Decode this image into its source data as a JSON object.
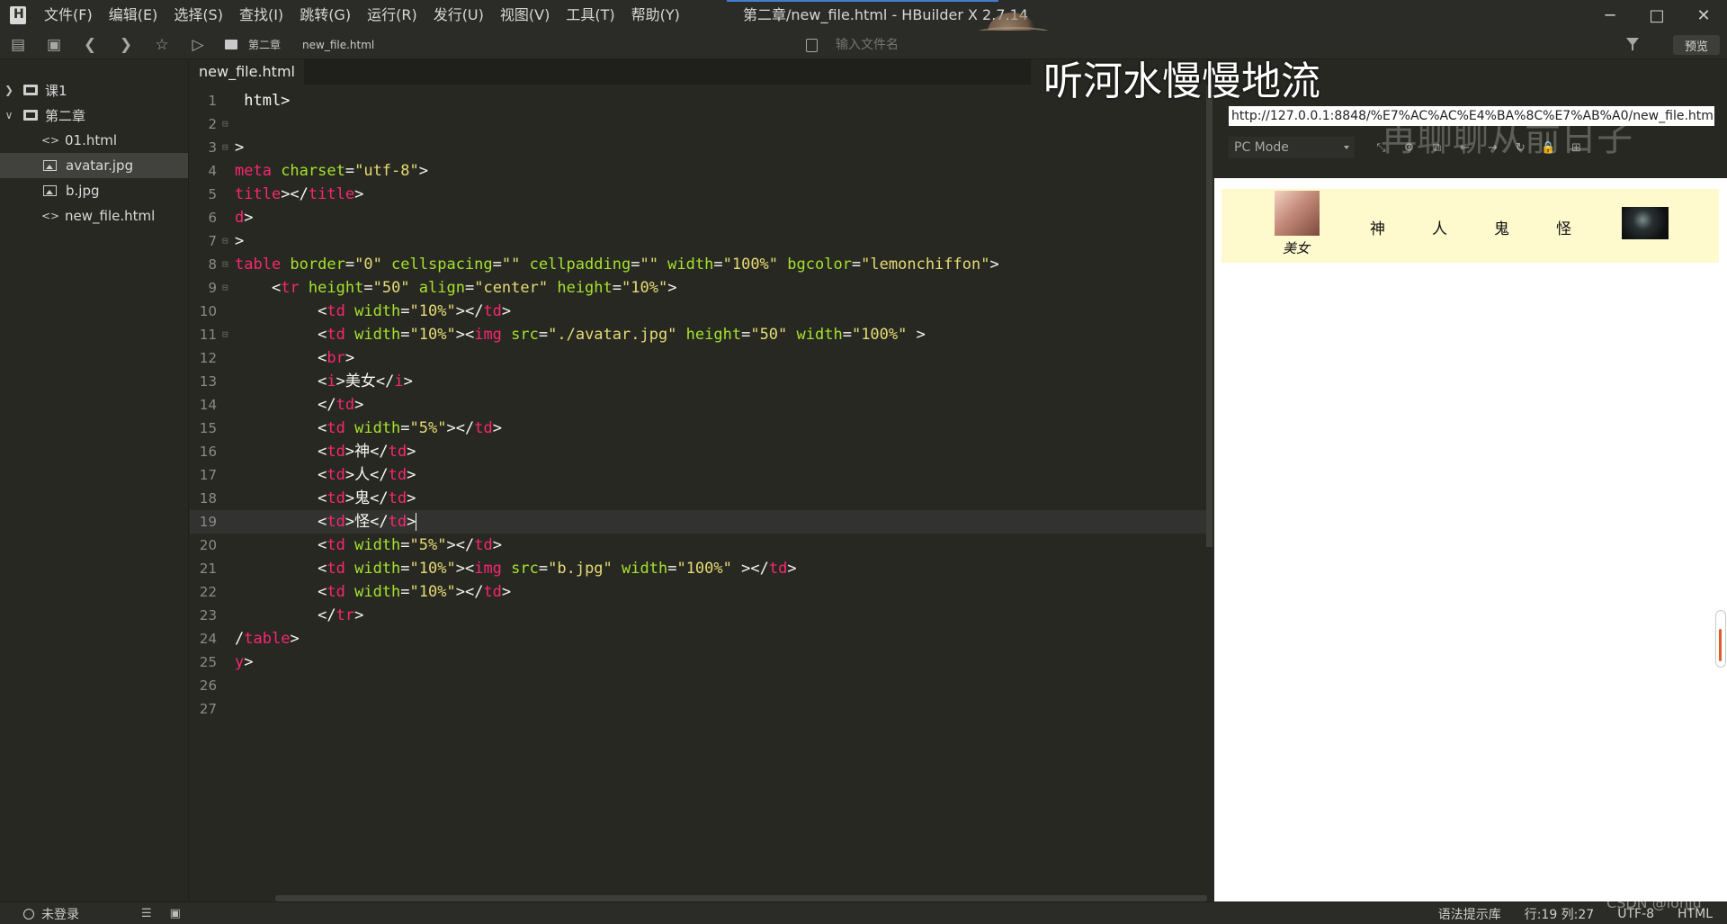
{
  "app": {
    "title": "第二章/new_file.html - HBuilder X 2.7.14",
    "menu": [
      "文件(F)",
      "编辑(E)",
      "选择(S)",
      "查找(I)",
      "跳转(G)",
      "运行(R)",
      "发行(U)",
      "视图(V)",
      "工具(T)",
      "帮助(Y)"
    ],
    "window_controls": {
      "minimize": "─",
      "maximize": "□",
      "close": "✕"
    }
  },
  "toolbar": {
    "icons": [
      "new-file-icon",
      "save-icon",
      "back-icon",
      "forward-icon",
      "star-icon",
      "run-icon"
    ],
    "breadcrumb": [
      "第二章",
      "new_file.html"
    ],
    "file_search_placeholder": "输入文件名",
    "preview_label": "预览"
  },
  "sidebar": {
    "items": [
      {
        "label": "课1",
        "kind": "folder",
        "expanded": false
      },
      {
        "label": "第二章",
        "kind": "folder",
        "expanded": true
      },
      {
        "label": "01.html",
        "kind": "html"
      },
      {
        "label": "avatar.jpg",
        "kind": "image",
        "selected": true
      },
      {
        "label": "b.jpg",
        "kind": "image"
      },
      {
        "label": "new_file.html",
        "kind": "html"
      }
    ]
  },
  "editor": {
    "tab": "new_file.html",
    "current_line": 19,
    "lines": [
      {
        "n": "1",
        "fold": "",
        "indent": "",
        "parts": [
          [
            "p",
            " html>"
          ]
        ]
      },
      {
        "n": "2",
        "fold": "⊟",
        "indent": "",
        "parts": []
      },
      {
        "n": "3",
        "fold": "⊟",
        "indent": "",
        "parts": [
          [
            "p",
            ">"
          ]
        ]
      },
      {
        "n": "4",
        "fold": "",
        "indent": "",
        "parts": [
          [
            "t",
            "meta"
          ],
          [
            "a",
            " charset"
          ],
          [
            "p",
            "="
          ],
          [
            "s",
            "\"utf-8\""
          ],
          [
            "p",
            ">"
          ]
        ]
      },
      {
        "n": "5",
        "fold": "",
        "indent": "",
        "parts": [
          [
            "t",
            "title"
          ],
          [
            "p",
            "></"
          ],
          [
            "t",
            "title"
          ],
          [
            "p",
            ">"
          ]
        ]
      },
      {
        "n": "6",
        "fold": "",
        "indent": "",
        "parts": [
          [
            "t",
            "d"
          ],
          [
            "p",
            ">"
          ]
        ]
      },
      {
        "n": "7",
        "fold": "⊟",
        "indent": "",
        "parts": [
          [
            "p",
            ">"
          ]
        ]
      },
      {
        "n": "8",
        "fold": "⊟",
        "indent": "",
        "parts": [
          [
            "t",
            "table"
          ],
          [
            "a",
            " border"
          ],
          [
            "p",
            "="
          ],
          [
            "s",
            "\"0\""
          ],
          [
            "a",
            " cellspacing"
          ],
          [
            "p",
            "="
          ],
          [
            "s",
            "\"\""
          ],
          [
            "a",
            " cellpadding"
          ],
          [
            "p",
            "="
          ],
          [
            "s",
            "\"\""
          ],
          [
            "a",
            " width"
          ],
          [
            "p",
            "="
          ],
          [
            "s",
            "\"100%\""
          ],
          [
            "a",
            " bgcolor"
          ],
          [
            "p",
            "="
          ],
          [
            "s",
            "\"lemonchiffon\""
          ],
          [
            "p",
            ">"
          ]
        ]
      },
      {
        "n": "9",
        "fold": "⊟",
        "indent": "    ",
        "parts": [
          [
            "p",
            "<"
          ],
          [
            "t",
            "tr"
          ],
          [
            "a",
            " height"
          ],
          [
            "p",
            "="
          ],
          [
            "s",
            "\"50\""
          ],
          [
            "a",
            " align"
          ],
          [
            "p",
            "="
          ],
          [
            "s",
            "\"center\""
          ],
          [
            "a",
            " height"
          ],
          [
            "p",
            "="
          ],
          [
            "s",
            "\"10%\""
          ],
          [
            "p",
            ">"
          ]
        ]
      },
      {
        "n": "10",
        "fold": "",
        "indent": "         ",
        "parts": [
          [
            "p",
            "<"
          ],
          [
            "t",
            "td"
          ],
          [
            "a",
            " width"
          ],
          [
            "p",
            "="
          ],
          [
            "s",
            "\"10%\""
          ],
          [
            "p",
            "></"
          ],
          [
            "t",
            "td"
          ],
          [
            "p",
            ">"
          ]
        ]
      },
      {
        "n": "11",
        "fold": "⊟",
        "indent": "         ",
        "parts": [
          [
            "p",
            "<"
          ],
          [
            "t",
            "td"
          ],
          [
            "a",
            " width"
          ],
          [
            "p",
            "="
          ],
          [
            "s",
            "\"10%\""
          ],
          [
            "p",
            "><"
          ],
          [
            "t",
            "img"
          ],
          [
            "a",
            " src"
          ],
          [
            "p",
            "="
          ],
          [
            "s",
            "\"./avatar.jpg\""
          ],
          [
            "a",
            " height"
          ],
          [
            "p",
            "="
          ],
          [
            "s",
            "\"50\""
          ],
          [
            "a",
            " width"
          ],
          [
            "p",
            "="
          ],
          [
            "s",
            "\"100%\""
          ],
          [
            "p",
            " >"
          ]
        ]
      },
      {
        "n": "12",
        "fold": "",
        "indent": "         ",
        "parts": [
          [
            "p",
            "<"
          ],
          [
            "t",
            "br"
          ],
          [
            "p",
            ">"
          ]
        ]
      },
      {
        "n": "13",
        "fold": "",
        "indent": "         ",
        "parts": [
          [
            "p",
            "<"
          ],
          [
            "t",
            "i"
          ],
          [
            "p",
            ">美女</"
          ],
          [
            "t",
            "i"
          ],
          [
            "p",
            ">"
          ]
        ]
      },
      {
        "n": "14",
        "fold": "",
        "indent": "         ",
        "parts": [
          [
            "p",
            "</"
          ],
          [
            "t",
            "td"
          ],
          [
            "p",
            ">"
          ]
        ]
      },
      {
        "n": "15",
        "fold": "",
        "indent": "         ",
        "parts": [
          [
            "p",
            "<"
          ],
          [
            "t",
            "td"
          ],
          [
            "a",
            " width"
          ],
          [
            "p",
            "="
          ],
          [
            "s",
            "\"5%\""
          ],
          [
            "p",
            "></"
          ],
          [
            "t",
            "td"
          ],
          [
            "p",
            ">"
          ]
        ]
      },
      {
        "n": "16",
        "fold": "",
        "indent": "         ",
        "parts": [
          [
            "p",
            "<"
          ],
          [
            "t",
            "td"
          ],
          [
            "p",
            ">神</"
          ],
          [
            "t",
            "td"
          ],
          [
            "p",
            ">"
          ]
        ]
      },
      {
        "n": "17",
        "fold": "",
        "indent": "         ",
        "parts": [
          [
            "p",
            "<"
          ],
          [
            "t",
            "td"
          ],
          [
            "p",
            ">人</"
          ],
          [
            "t",
            "td"
          ],
          [
            "p",
            ">"
          ]
        ]
      },
      {
        "n": "18",
        "fold": "",
        "indent": "         ",
        "parts": [
          [
            "p",
            "<"
          ],
          [
            "t",
            "td"
          ],
          [
            "p",
            ">鬼</"
          ],
          [
            "t",
            "td"
          ],
          [
            "p",
            ">"
          ]
        ]
      },
      {
        "n": "19",
        "fold": "",
        "indent": "         ",
        "parts": [
          [
            "p",
            "<"
          ],
          [
            "t",
            "td"
          ],
          [
            "p",
            ">怪</"
          ],
          [
            "t",
            "td"
          ],
          [
            "p",
            ">"
          ]
        ]
      },
      {
        "n": "20",
        "fold": "",
        "indent": "         ",
        "parts": [
          [
            "p",
            "<"
          ],
          [
            "t",
            "td"
          ],
          [
            "a",
            " width"
          ],
          [
            "p",
            "="
          ],
          [
            "s",
            "\"5%\""
          ],
          [
            "p",
            "></"
          ],
          [
            "t",
            "td"
          ],
          [
            "p",
            ">"
          ]
        ]
      },
      {
        "n": "21",
        "fold": "",
        "indent": "         ",
        "parts": [
          [
            "p",
            "<"
          ],
          [
            "t",
            "td"
          ],
          [
            "a",
            " width"
          ],
          [
            "p",
            "="
          ],
          [
            "s",
            "\"10%\""
          ],
          [
            "p",
            "><"
          ],
          [
            "t",
            "img"
          ],
          [
            "a",
            " src"
          ],
          [
            "p",
            "="
          ],
          [
            "s",
            "\"b.jpg\""
          ],
          [
            "a",
            " width"
          ],
          [
            "p",
            "="
          ],
          [
            "s",
            "\"100%\""
          ],
          [
            "p",
            " ></"
          ],
          [
            "t",
            "td"
          ],
          [
            "p",
            ">"
          ]
        ]
      },
      {
        "n": "22",
        "fold": "",
        "indent": "         ",
        "parts": [
          [
            "p",
            "<"
          ],
          [
            "t",
            "td"
          ],
          [
            "a",
            " width"
          ],
          [
            "p",
            "="
          ],
          [
            "s",
            "\"10%\""
          ],
          [
            "p",
            "></"
          ],
          [
            "t",
            "td"
          ],
          [
            "p",
            ">"
          ]
        ]
      },
      {
        "n": "23",
        "fold": "",
        "indent": "         ",
        "parts": [
          [
            "p",
            "</"
          ],
          [
            "t",
            "tr"
          ],
          [
            "p",
            ">"
          ]
        ]
      },
      {
        "n": "24",
        "fold": "",
        "indent": "",
        "parts": [
          [
            "p",
            "/"
          ],
          [
            "t",
            "table"
          ],
          [
            "p",
            ">"
          ]
        ]
      },
      {
        "n": "25",
        "fold": "",
        "indent": "",
        "parts": [
          [
            "t",
            "y"
          ],
          [
            "p",
            ">"
          ]
        ]
      },
      {
        "n": "26",
        "fold": "",
        "indent": "",
        "parts": []
      },
      {
        "n": "27",
        "fold": "",
        "indent": "",
        "parts": []
      }
    ]
  },
  "preview": {
    "url": "http://127.0.0.1:8848/%E7%AC%AC%E4%BA%8C%E7%AB%A0/new_file.html",
    "mode": "PC Mode",
    "tools": [
      "⤡",
      "⚙",
      "⧉",
      "←",
      "→",
      "↻",
      "🔒",
      "⊞"
    ],
    "row_bgcolor": "#fffacd",
    "caption": "美女",
    "cells": [
      "神",
      "人",
      "鬼",
      "怪"
    ]
  },
  "overlay": {
    "lyric": "听河水慢慢地流",
    "lyric_faded": "再聊聊从前日子"
  },
  "statusbar": {
    "user": "未登录",
    "syntax_lib": "语法提示库",
    "position": "行:19  列:27",
    "encoding": "UTF-8",
    "language": "HTML"
  },
  "watermark": "CSDN @lonju"
}
